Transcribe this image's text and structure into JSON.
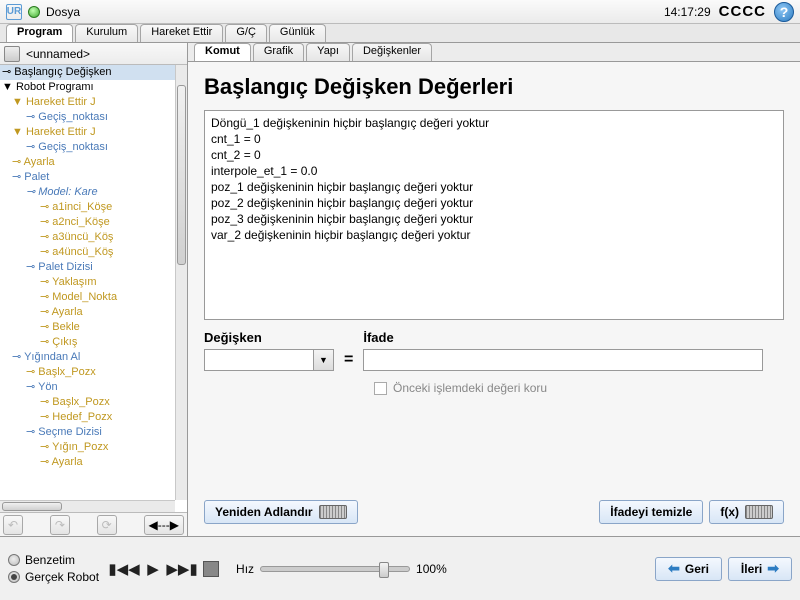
{
  "topbar": {
    "file_menu": "Dosya",
    "time": "14:17:29",
    "cccc": "CCCC"
  },
  "maintabs": [
    "Program",
    "Kurulum",
    "Hareket Ettir",
    "G/Ç",
    "Günlük"
  ],
  "active_maintab": 0,
  "filename": "<unnamed>",
  "tree": [
    {
      "d": 0,
      "cls": "sel",
      "text": "Başlangıç Değişken"
    },
    {
      "d": 0,
      "cls": "",
      "pre": "▼ ",
      "text": "Robot Programı"
    },
    {
      "d": 1,
      "cls": "ty",
      "pre": "▼ ",
      "text": "Hareket Ettir J"
    },
    {
      "d": 2,
      "cls": "tb",
      "pre": "",
      "text": "Geçiş_noktası"
    },
    {
      "d": 1,
      "cls": "ty",
      "pre": "▼ ",
      "text": "Hareket Ettir J"
    },
    {
      "d": 2,
      "cls": "tb",
      "pre": "",
      "text": "Geçiş_noktası"
    },
    {
      "d": 1,
      "cls": "ty",
      "pre": "",
      "text": "Ayarla"
    },
    {
      "d": 1,
      "cls": "tb",
      "pre": "",
      "text": "Palet"
    },
    {
      "d": 2,
      "cls": "tb ti",
      "pre": "",
      "text": "Model: Kare"
    },
    {
      "d": 3,
      "cls": "ty",
      "pre": "",
      "text": "a1inci_Köşe"
    },
    {
      "d": 3,
      "cls": "ty",
      "pre": "",
      "text": "a2nci_Köşe"
    },
    {
      "d": 3,
      "cls": "ty",
      "pre": "",
      "text": "a3üncü_Köş"
    },
    {
      "d": 3,
      "cls": "ty",
      "pre": "",
      "text": "a4üncü_Köş"
    },
    {
      "d": 2,
      "cls": "tb",
      "pre": "",
      "text": "Palet Dizisi"
    },
    {
      "d": 3,
      "cls": "ty",
      "pre": "",
      "text": "Yaklaşım"
    },
    {
      "d": 3,
      "cls": "ty",
      "pre": "",
      "text": "Model_Nokta"
    },
    {
      "d": 3,
      "cls": "ty",
      "pre": "",
      "text": "Ayarla"
    },
    {
      "d": 3,
      "cls": "ty",
      "pre": "",
      "text": "Bekle"
    },
    {
      "d": 3,
      "cls": "ty",
      "pre": "",
      "text": "Çıkış"
    },
    {
      "d": 1,
      "cls": "tb",
      "pre": "",
      "text": "Yığından Al"
    },
    {
      "d": 2,
      "cls": "ty",
      "pre": "",
      "text": "Başlx_Pozx"
    },
    {
      "d": 2,
      "cls": "tb",
      "pre": "",
      "text": "Yön"
    },
    {
      "d": 3,
      "cls": "ty",
      "pre": "",
      "text": "Başlx_Pozx"
    },
    {
      "d": 3,
      "cls": "ty",
      "pre": "",
      "text": "Hedef_Pozx"
    },
    {
      "d": 2,
      "cls": "tb",
      "pre": "",
      "text": "Seçme Dizisi"
    },
    {
      "d": 3,
      "cls": "ty",
      "pre": "",
      "text": "Yığın_Pozx"
    },
    {
      "d": 3,
      "cls": "ty",
      "pre": "",
      "text": "Ayarla"
    }
  ],
  "subtabs": [
    "Komut",
    "Grafik",
    "Yapı",
    "Değişkenler"
  ],
  "active_subtab": 0,
  "panel": {
    "title": "Başlangıç Değişken Değerleri",
    "lines": [
      "Döngü_1 değişkeninin hiçbir başlangıç değeri yoktur",
      "cnt_1 = 0",
      "cnt_2 = 0",
      "interpole_et_1 = 0.0",
      "poz_1 değişkeninin hiçbir başlangıç değeri yoktur",
      "poz_2 değişkeninin hiçbir başlangıç değeri yoktur",
      "poz_3 değişkeninin hiçbir başlangıç değeri yoktur",
      "var_2 değişkeninin hiçbir başlangıç değeri yoktur"
    ],
    "var_label": "Değişken",
    "expr_label": "İfade",
    "keep_label": "Önceki işlemdeki değeri koru",
    "rename_btn": "Yeniden Adlandır",
    "clear_btn": "İfadeyi temizle",
    "fx_btn": "f(x)"
  },
  "bottom": {
    "sim": "Benzetim",
    "real": "Gerçek Robot",
    "speed_label": "Hız",
    "speed_value": "100%",
    "back": "Geri",
    "next": "İleri"
  }
}
